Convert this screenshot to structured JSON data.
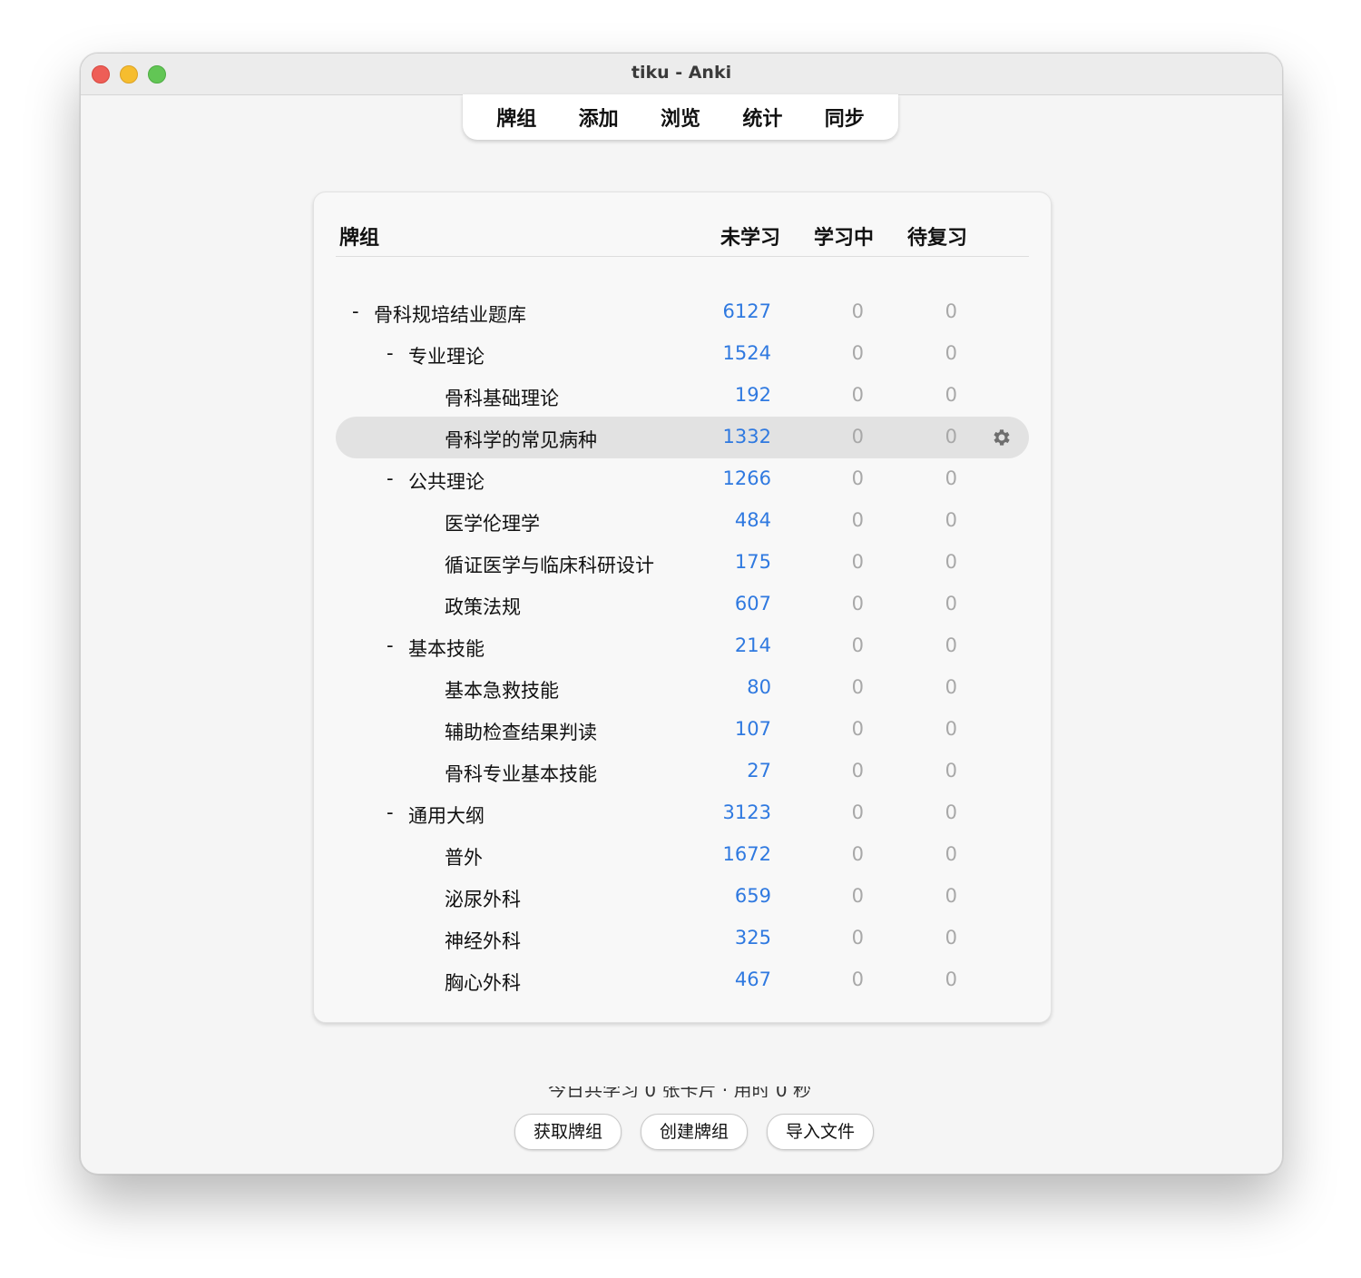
{
  "window": {
    "title": "tiku - Anki"
  },
  "toolbar": {
    "tabs": [
      "牌组",
      "添加",
      "浏览",
      "统计",
      "同步"
    ]
  },
  "deck_table": {
    "headers": {
      "deck": "牌组",
      "new": "未学习",
      "learn": "学习中",
      "review": "待复习"
    },
    "rows": [
      {
        "collapse": "-",
        "name": "骨科规培结业题库",
        "new": "6127",
        "learn": "0",
        "review": "0"
      },
      {
        "collapse": "-",
        "name": "专业理论",
        "new": "1524",
        "learn": "0",
        "review": "0"
      },
      {
        "collapse": "",
        "name": "骨科基础理论",
        "new": "192",
        "learn": "0",
        "review": "0"
      },
      {
        "collapse": "",
        "name": "骨科学的常见病种",
        "new": "1332",
        "learn": "0",
        "review": "0"
      },
      {
        "collapse": "-",
        "name": "公共理论",
        "new": "1266",
        "learn": "0",
        "review": "0"
      },
      {
        "collapse": "",
        "name": "医学伦理学",
        "new": "484",
        "learn": "0",
        "review": "0"
      },
      {
        "collapse": "",
        "name": "循证医学与临床科研设计",
        "new": "175",
        "learn": "0",
        "review": "0"
      },
      {
        "collapse": "",
        "name": "政策法规",
        "new": "607",
        "learn": "0",
        "review": "0"
      },
      {
        "collapse": "-",
        "name": "基本技能",
        "new": "214",
        "learn": "0",
        "review": "0"
      },
      {
        "collapse": "",
        "name": "基本急救技能",
        "new": "80",
        "learn": "0",
        "review": "0"
      },
      {
        "collapse": "",
        "name": "辅助检查结果判读",
        "new": "107",
        "learn": "0",
        "review": "0"
      },
      {
        "collapse": "",
        "name": "骨科专业基本技能",
        "new": "27",
        "learn": "0",
        "review": "0"
      },
      {
        "collapse": "-",
        "name": "通用大纲",
        "new": "3123",
        "learn": "0",
        "review": "0"
      },
      {
        "collapse": "",
        "name": "普外",
        "new": "1672",
        "learn": "0",
        "review": "0"
      },
      {
        "collapse": "",
        "name": "泌尿外科",
        "new": "659",
        "learn": "0",
        "review": "0"
      },
      {
        "collapse": "",
        "name": "神经外科",
        "new": "325",
        "learn": "0",
        "review": "0"
      },
      {
        "collapse": "",
        "name": "胸心外科",
        "new": "467",
        "learn": "0",
        "review": "0"
      }
    ],
    "selected_row": 3,
    "gear_icon": "gear-icon"
  },
  "bottom": {
    "buttons": {
      "get_shared": "获取牌组",
      "create_deck": "创建牌组",
      "import_file": "导入文件"
    }
  },
  "colors": {
    "new_count": "#2f79e0",
    "zero_count": "#a8a8a8",
    "selected_row": "#e2e2e2"
  }
}
